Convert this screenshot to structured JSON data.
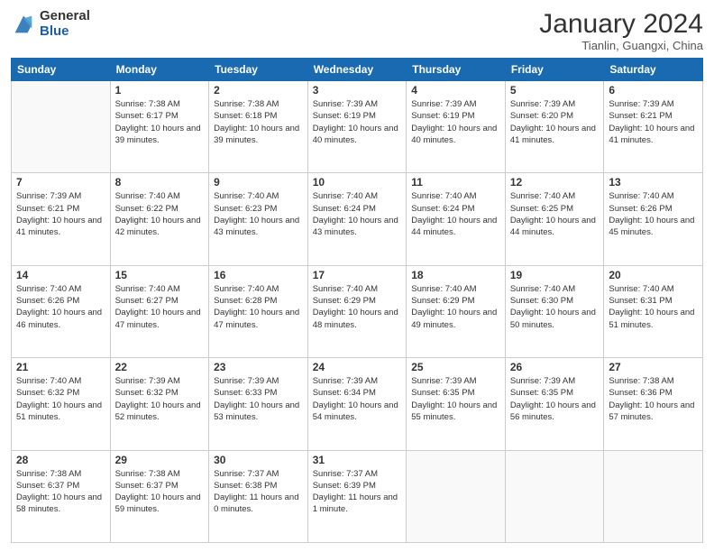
{
  "logo": {
    "general": "General",
    "blue": "Blue"
  },
  "header": {
    "month_year": "January 2024",
    "location": "Tianlin, Guangxi, China"
  },
  "weekdays": [
    "Sunday",
    "Monday",
    "Tuesday",
    "Wednesday",
    "Thursday",
    "Friday",
    "Saturday"
  ],
  "weeks": [
    [
      {
        "day": "",
        "sunrise": "",
        "sunset": "",
        "daylight": ""
      },
      {
        "day": "1",
        "sunrise": "Sunrise: 7:38 AM",
        "sunset": "Sunset: 6:17 PM",
        "daylight": "Daylight: 10 hours and 39 minutes."
      },
      {
        "day": "2",
        "sunrise": "Sunrise: 7:38 AM",
        "sunset": "Sunset: 6:18 PM",
        "daylight": "Daylight: 10 hours and 39 minutes."
      },
      {
        "day": "3",
        "sunrise": "Sunrise: 7:39 AM",
        "sunset": "Sunset: 6:19 PM",
        "daylight": "Daylight: 10 hours and 40 minutes."
      },
      {
        "day": "4",
        "sunrise": "Sunrise: 7:39 AM",
        "sunset": "Sunset: 6:19 PM",
        "daylight": "Daylight: 10 hours and 40 minutes."
      },
      {
        "day": "5",
        "sunrise": "Sunrise: 7:39 AM",
        "sunset": "Sunset: 6:20 PM",
        "daylight": "Daylight: 10 hours and 41 minutes."
      },
      {
        "day": "6",
        "sunrise": "Sunrise: 7:39 AM",
        "sunset": "Sunset: 6:21 PM",
        "daylight": "Daylight: 10 hours and 41 minutes."
      }
    ],
    [
      {
        "day": "7",
        "sunrise": "Sunrise: 7:39 AM",
        "sunset": "Sunset: 6:21 PM",
        "daylight": "Daylight: 10 hours and 41 minutes."
      },
      {
        "day": "8",
        "sunrise": "Sunrise: 7:40 AM",
        "sunset": "Sunset: 6:22 PM",
        "daylight": "Daylight: 10 hours and 42 minutes."
      },
      {
        "day": "9",
        "sunrise": "Sunrise: 7:40 AM",
        "sunset": "Sunset: 6:23 PM",
        "daylight": "Daylight: 10 hours and 43 minutes."
      },
      {
        "day": "10",
        "sunrise": "Sunrise: 7:40 AM",
        "sunset": "Sunset: 6:24 PM",
        "daylight": "Daylight: 10 hours and 43 minutes."
      },
      {
        "day": "11",
        "sunrise": "Sunrise: 7:40 AM",
        "sunset": "Sunset: 6:24 PM",
        "daylight": "Daylight: 10 hours and 44 minutes."
      },
      {
        "day": "12",
        "sunrise": "Sunrise: 7:40 AM",
        "sunset": "Sunset: 6:25 PM",
        "daylight": "Daylight: 10 hours and 44 minutes."
      },
      {
        "day": "13",
        "sunrise": "Sunrise: 7:40 AM",
        "sunset": "Sunset: 6:26 PM",
        "daylight": "Daylight: 10 hours and 45 minutes."
      }
    ],
    [
      {
        "day": "14",
        "sunrise": "Sunrise: 7:40 AM",
        "sunset": "Sunset: 6:26 PM",
        "daylight": "Daylight: 10 hours and 46 minutes."
      },
      {
        "day": "15",
        "sunrise": "Sunrise: 7:40 AM",
        "sunset": "Sunset: 6:27 PM",
        "daylight": "Daylight: 10 hours and 47 minutes."
      },
      {
        "day": "16",
        "sunrise": "Sunrise: 7:40 AM",
        "sunset": "Sunset: 6:28 PM",
        "daylight": "Daylight: 10 hours and 47 minutes."
      },
      {
        "day": "17",
        "sunrise": "Sunrise: 7:40 AM",
        "sunset": "Sunset: 6:29 PM",
        "daylight": "Daylight: 10 hours and 48 minutes."
      },
      {
        "day": "18",
        "sunrise": "Sunrise: 7:40 AM",
        "sunset": "Sunset: 6:29 PM",
        "daylight": "Daylight: 10 hours and 49 minutes."
      },
      {
        "day": "19",
        "sunrise": "Sunrise: 7:40 AM",
        "sunset": "Sunset: 6:30 PM",
        "daylight": "Daylight: 10 hours and 50 minutes."
      },
      {
        "day": "20",
        "sunrise": "Sunrise: 7:40 AM",
        "sunset": "Sunset: 6:31 PM",
        "daylight": "Daylight: 10 hours and 51 minutes."
      }
    ],
    [
      {
        "day": "21",
        "sunrise": "Sunrise: 7:40 AM",
        "sunset": "Sunset: 6:32 PM",
        "daylight": "Daylight: 10 hours and 51 minutes."
      },
      {
        "day": "22",
        "sunrise": "Sunrise: 7:39 AM",
        "sunset": "Sunset: 6:32 PM",
        "daylight": "Daylight: 10 hours and 52 minutes."
      },
      {
        "day": "23",
        "sunrise": "Sunrise: 7:39 AM",
        "sunset": "Sunset: 6:33 PM",
        "daylight": "Daylight: 10 hours and 53 minutes."
      },
      {
        "day": "24",
        "sunrise": "Sunrise: 7:39 AM",
        "sunset": "Sunset: 6:34 PM",
        "daylight": "Daylight: 10 hours and 54 minutes."
      },
      {
        "day": "25",
        "sunrise": "Sunrise: 7:39 AM",
        "sunset": "Sunset: 6:35 PM",
        "daylight": "Daylight: 10 hours and 55 minutes."
      },
      {
        "day": "26",
        "sunrise": "Sunrise: 7:39 AM",
        "sunset": "Sunset: 6:35 PM",
        "daylight": "Daylight: 10 hours and 56 minutes."
      },
      {
        "day": "27",
        "sunrise": "Sunrise: 7:38 AM",
        "sunset": "Sunset: 6:36 PM",
        "daylight": "Daylight: 10 hours and 57 minutes."
      }
    ],
    [
      {
        "day": "28",
        "sunrise": "Sunrise: 7:38 AM",
        "sunset": "Sunset: 6:37 PM",
        "daylight": "Daylight: 10 hours and 58 minutes."
      },
      {
        "day": "29",
        "sunrise": "Sunrise: 7:38 AM",
        "sunset": "Sunset: 6:37 PM",
        "daylight": "Daylight: 10 hours and 59 minutes."
      },
      {
        "day": "30",
        "sunrise": "Sunrise: 7:37 AM",
        "sunset": "Sunset: 6:38 PM",
        "daylight": "Daylight: 11 hours and 0 minutes."
      },
      {
        "day": "31",
        "sunrise": "Sunrise: 7:37 AM",
        "sunset": "Sunset: 6:39 PM",
        "daylight": "Daylight: 11 hours and 1 minute."
      },
      {
        "day": "",
        "sunrise": "",
        "sunset": "",
        "daylight": ""
      },
      {
        "day": "",
        "sunrise": "",
        "sunset": "",
        "daylight": ""
      },
      {
        "day": "",
        "sunrise": "",
        "sunset": "",
        "daylight": ""
      }
    ]
  ]
}
